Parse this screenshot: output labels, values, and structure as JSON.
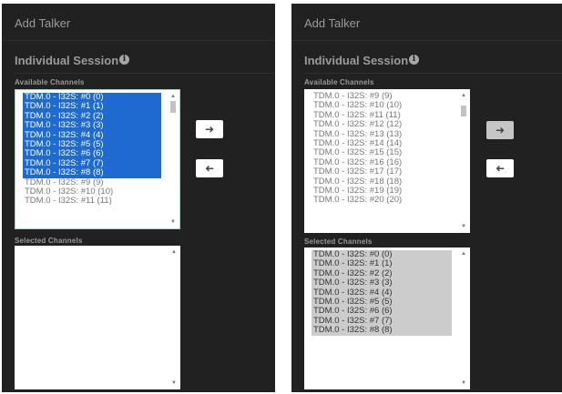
{
  "left": {
    "title": "Add Talker",
    "section": "Individual Session",
    "available_label": "Available Channels",
    "selected_label": "Selected Channels",
    "available_items": [
      "TDM.0 - I32S: #0 (0)",
      "TDM.0 - I32S: #1 (1)",
      "TDM.0 - I32S: #2 (2)",
      "TDM.0 - I32S: #3 (3)",
      "TDM.0 - I32S: #4 (4)",
      "TDM.0 - I32S: #5 (5)",
      "TDM.0 - I32S: #6 (6)",
      "TDM.0 - I32S: #7 (7)",
      "TDM.0 - I32S: #8 (8)",
      "TDM.0 - I32S: #9 (9)",
      "TDM.0 - I32S: #10 (10)",
      "TDM.0 - I32S: #11 (11)"
    ],
    "highlighted_count": 9,
    "selected_items": [],
    "move_right_icon": "arrow-right",
    "move_left_icon": "arrow-left"
  },
  "right": {
    "title": "Add Talker",
    "section": "Individual Session",
    "available_label": "Available Channels",
    "selected_label": "Selected Channels",
    "available_items": [
      "TDM.0 - I32S: #9 (9)",
      "TDM.0 - I32S: #10 (10)",
      "TDM.0 - I32S: #11 (11)",
      "TDM.0 - I32S: #12 (12)",
      "TDM.0 - I32S: #13 (13)",
      "TDM.0 - I32S: #14 (14)",
      "TDM.0 - I32S: #15 (15)",
      "TDM.0 - I32S: #16 (16)",
      "TDM.0 - I32S: #17 (17)",
      "TDM.0 - I32S: #18 (18)",
      "TDM.0 - I32S: #19 (19)",
      "TDM.0 - I32S: #20 (20)"
    ],
    "selected_items": [
      "TDM.0 - I32S: #0 (0)",
      "TDM.0 - I32S: #1 (1)",
      "TDM.0 - I32S: #2 (2)",
      "TDM.0 - I32S: #3 (3)",
      "TDM.0 - I32S: #4 (4)",
      "TDM.0 - I32S: #5 (5)",
      "TDM.0 - I32S: #6 (6)",
      "TDM.0 - I32S: #7 (7)",
      "TDM.0 - I32S: #8 (8)"
    ],
    "move_right_icon": "arrow-right",
    "move_left_icon": "arrow-left"
  },
  "colors": {
    "panel_bg": "#212121",
    "selection_blue": "#1e6ad0",
    "selection_gray": "#cccccc",
    "focus_border": "#9fd9b6"
  }
}
